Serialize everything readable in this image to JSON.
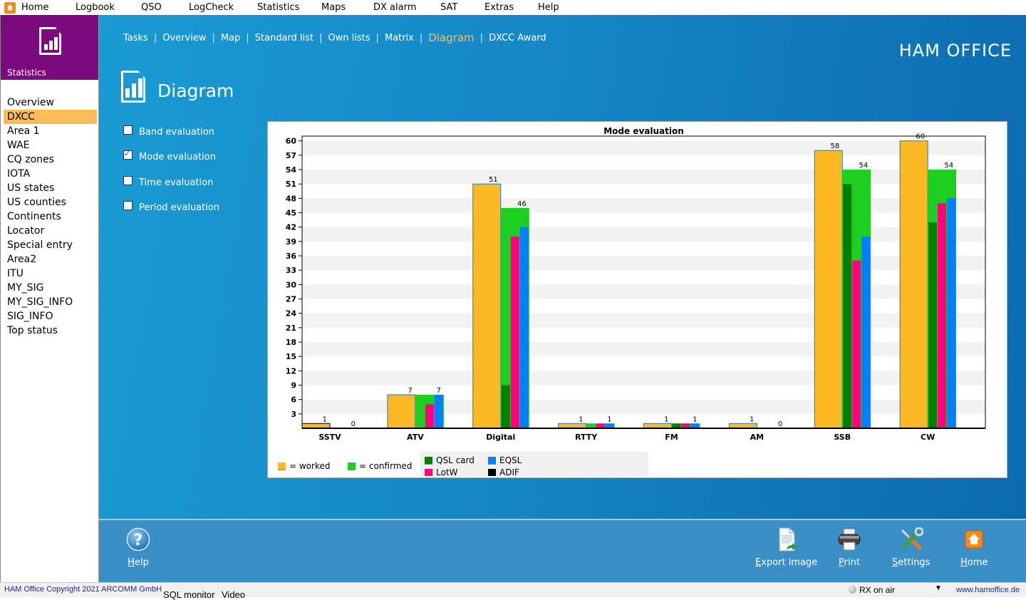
{
  "menubar": {
    "items": [
      "Home",
      "Logbook",
      "QSO",
      "LogCheck",
      "Statistics",
      "Maps",
      "DX alarm",
      "SAT",
      "Extras",
      "Help"
    ]
  },
  "sidebar": {
    "title": "Statistics",
    "items": [
      "Overview",
      "DXCC",
      "Area 1",
      "WAE",
      "CQ zones",
      "IOTA",
      "US states",
      "US counties",
      "Continents",
      "Locator",
      "Special entry",
      "Area2",
      "ITU",
      "MY_SIG",
      "MY_SIG_INFO",
      "SIG_INFO",
      "Top status"
    ],
    "active_index": 1
  },
  "topnav": {
    "items": [
      "Tasks",
      "Overview",
      "Map",
      "Standard list",
      "Own lists",
      "Matrix",
      "Diagram",
      "DXCC Award"
    ],
    "active_index": 6
  },
  "brand": "HAM OFFICE",
  "page_title": "Diagram",
  "options": [
    {
      "label": "Band evaluation",
      "checked": false
    },
    {
      "label": "Mode evaluation",
      "checked": true
    },
    {
      "label": "Time evaluation",
      "checked": false
    },
    {
      "label": "Period evaluation",
      "checked": false
    }
  ],
  "colors": {
    "worked": "#fdb924",
    "confirmed": "#1ecf22",
    "qsl_card": "#008000",
    "lotw": "#ff0080",
    "eqsl": "#0080ff",
    "adif": "#000000",
    "accent": "#fbbc5c",
    "sidebar_header": "#7b0a7f"
  },
  "chart_data": {
    "type": "bar",
    "title": "Mode evaluation",
    "xlabel": "",
    "ylabel": "",
    "ylim": [
      0,
      61
    ],
    "yticks": [
      3,
      6,
      9,
      12,
      15,
      18,
      21,
      24,
      27,
      30,
      33,
      36,
      39,
      42,
      45,
      48,
      51,
      54,
      57,
      60
    ],
    "grid": true,
    "categories": [
      "SSTV",
      "ATV",
      "Digital",
      "RTTY",
      "FM",
      "AM",
      "SSB",
      "CW"
    ],
    "series": [
      {
        "name": "worked",
        "values": [
          1,
          7,
          51,
          1,
          1,
          1,
          58,
          60
        ]
      },
      {
        "name": "confirmed",
        "values": [
          0,
          7,
          46,
          1,
          1,
          0,
          54,
          54
        ]
      },
      {
        "name": "QSL card",
        "values": [
          0,
          0,
          9,
          0,
          1,
          0,
          51,
          43
        ]
      },
      {
        "name": "LotW",
        "values": [
          0,
          5,
          40,
          1,
          1,
          0,
          35,
          47
        ]
      },
      {
        "name": "EQSL",
        "values": [
          0,
          7,
          42,
          1,
          1,
          0,
          40,
          48
        ]
      }
    ],
    "legend": {
      "position": "bottom",
      "entries": [
        "= worked",
        "= confirmed",
        "QSL card",
        "EQSL",
        "LotW",
        "ADIF"
      ]
    }
  },
  "toolbar": {
    "help": "Help",
    "export_image": "Export image",
    "print": "Print",
    "settings": "Settings",
    "home": "Home"
  },
  "statusbar": {
    "copyright": "HAM Office Copyright 2021 ARCOMM GmbH",
    "sql_monitor": "SQL monitor",
    "video": "Video",
    "rx_status": "RX on air",
    "website": "www.hamoffice.de"
  }
}
